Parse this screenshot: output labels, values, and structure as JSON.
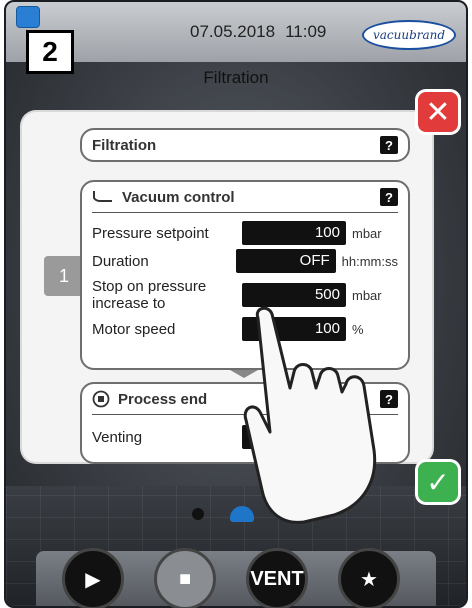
{
  "status_bar": {
    "date": "07.05.2018",
    "time": "11:09",
    "brand": "vacuubrand"
  },
  "step_badge": "2",
  "screen_title": "Filtration",
  "side_tab": "1",
  "panels": {
    "filtration": {
      "title": "Filtration",
      "help": "?"
    },
    "vacuum_control": {
      "title": "Vacuum control",
      "help": "?",
      "rows": [
        {
          "label": "Pressure setpoint",
          "value": "100",
          "unit": "mbar"
        },
        {
          "label": "Duration",
          "value": "OFF",
          "unit": "hh:mm:ss"
        },
        {
          "label": "Stop on pressure increase to",
          "value": "500",
          "unit": "mbar"
        },
        {
          "label": "Motor speed",
          "value": "100",
          "unit": "%"
        }
      ]
    },
    "process_end": {
      "title": "Process end",
      "help": "?",
      "rows": [
        {
          "label": "Venting",
          "value": ""
        }
      ]
    }
  },
  "buttons": {
    "close": "✕",
    "confirm": "✓",
    "play": "▶",
    "stop": "■",
    "vent": "VENT",
    "favorite": "★"
  },
  "colors": {
    "close": "#e23b3b",
    "confirm": "#3db04f",
    "accent": "#1f75c8"
  }
}
